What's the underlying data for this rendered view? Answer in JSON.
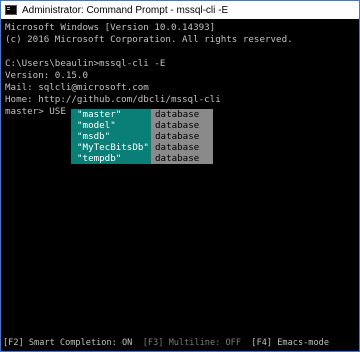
{
  "window": {
    "title": "Administrator: Command Prompt - mssql-cli  -E"
  },
  "console": {
    "lines": [
      "Microsoft Windows [Version 10.0.14393]",
      "(c) 2016 Microsoft Corporation. All rights reserved.",
      "",
      "C:\\Users\\beaulin>mssql-cli -E",
      "Version: 0.15.0",
      "Mail: sqlcli@microsoft.com",
      "Home: http://github.com/dbcli/mssql-cli",
      "master> USE "
    ]
  },
  "completion": {
    "items": [
      {
        "name": "\"master\"",
        "type": "database"
      },
      {
        "name": "\"model\"",
        "type": "database"
      },
      {
        "name": "\"msdb\"",
        "type": "database"
      },
      {
        "name": "\"MyTecBitsDb\"",
        "type": "database"
      },
      {
        "name": "\"tempdb\"",
        "type": "database"
      }
    ]
  },
  "toolbar": {
    "smart_completion": "[F2] Smart Completion: ON",
    "multiline": "[F3] Multiline: OFF",
    "emacs_mode": "[F4] Emacs-mode"
  },
  "colors": {
    "completion_name_bg": "#0a7f77",
    "completion_type_bg": "#8a8a8a",
    "console_text": "#c0c0c0"
  }
}
